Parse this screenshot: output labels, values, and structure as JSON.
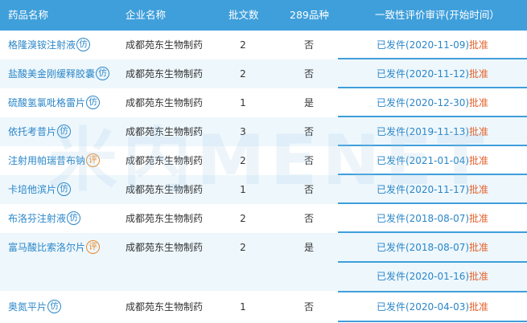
{
  "columns": {
    "drug": "药品名称",
    "company": "企业名称",
    "batch": "批文数",
    "flag": "289品种",
    "eval": "一致性评价审评(开始时间）"
  },
  "badges": {
    "imitation": "仿",
    "evaluation": "评"
  },
  "rows": [
    {
      "drug": "格隆溴铵注射液",
      "badge": "仿",
      "company": "成都苑东生物制药",
      "batch": "2",
      "flag": "否",
      "eval_text": "已发件(2020-11-09)",
      "eval_status": "批准"
    },
    {
      "drug": "盐酸美金刚缓释胶囊",
      "badge": "仿",
      "company": "成都苑东生物制药",
      "batch": "2",
      "flag": "否",
      "eval_text": "已发件(2020-11-12)",
      "eval_status": "批准"
    },
    {
      "drug": "硫酸氢氯吡格雷片",
      "badge": "仿",
      "company": "成都苑东生物制药",
      "batch": "1",
      "flag": "是",
      "eval_text": "已发件(2020-12-30)",
      "eval_status": "批准"
    },
    {
      "drug": "依托考昔片",
      "badge": "仿",
      "company": "成都苑东生物制药",
      "batch": "3",
      "flag": "否",
      "eval_text": "已发件(2019-11-13)",
      "eval_status": "批准"
    },
    {
      "drug": "注射用帕瑞昔布钠",
      "badge": "评",
      "company": "成都苑东生物制药",
      "batch": "2",
      "flag": "否",
      "eval_text": "已发件(2021-01-04)",
      "eval_status": "批准"
    },
    {
      "drug": "卡培他滨片",
      "badge": "仿",
      "company": "成都苑东生物制药",
      "batch": "1",
      "flag": "否",
      "eval_text": "已发件(2020-11-17)",
      "eval_status": "批准"
    },
    {
      "drug": "布洛芬注射液",
      "badge": "仿",
      "company": "成都苑东生物制药",
      "batch": "2",
      "flag": "否",
      "eval_text": "已发件(2018-08-07)",
      "eval_status": "批准"
    },
    {
      "drug": "富马酸比索洛尔片",
      "badge": "评",
      "company": "成都苑东生物制药",
      "batch": "2",
      "flag": "是",
      "eval_text": "已发件(2018-08-07)",
      "eval_status": "批准"
    },
    {
      "drug": "",
      "badge": "",
      "company": "",
      "batch": "",
      "flag": "",
      "eval_text": "已发件(2020-01-16)",
      "eval_status": "批准"
    },
    {
      "drug": "奥氮平片",
      "badge": "仿",
      "company": "成都苑东生物制药",
      "batch": "1",
      "flag": "否",
      "eval_text": "已发件(2020-04-03)",
      "eval_status": "批准"
    }
  ],
  "watermark": "米内MENET",
  "colors": {
    "header_bg": "#3f9fdb",
    "link": "#2a86c8",
    "approve": "#e4622c",
    "alt_row": "#eef7fc",
    "eval_badge": "#e88a2c"
  }
}
